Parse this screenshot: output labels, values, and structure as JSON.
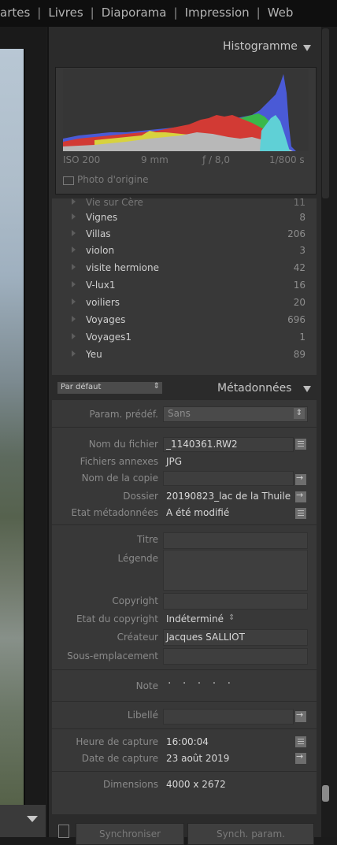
{
  "top_nav": {
    "items": [
      "artes",
      "Livres",
      "Diaporama",
      "Impression",
      "Web"
    ]
  },
  "histogram": {
    "title": "Histogramme",
    "iso": "ISO 200",
    "focal": "9 mm",
    "aperture": "ƒ / 8,0",
    "shutter": "1/800 s",
    "original_photo_label": "Photo d'origine"
  },
  "keywords": {
    "rows": [
      {
        "name": "Vie sur Cère",
        "count": "11",
        "cut": true
      },
      {
        "name": "Vignes",
        "count": "8"
      },
      {
        "name": "Villas",
        "count": "206"
      },
      {
        "name": "violon",
        "count": "3"
      },
      {
        "name": "visite hermione",
        "count": "42"
      },
      {
        "name": "V-lux1",
        "count": "16"
      },
      {
        "name": "voiliers",
        "count": "20"
      },
      {
        "name": "Voyages",
        "count": "696"
      },
      {
        "name": "Voyages1",
        "count": "1"
      },
      {
        "name": "Yeu",
        "count": "89"
      }
    ]
  },
  "metadata": {
    "preset_select": "Par défaut",
    "title": "Métadonnées",
    "preset_label": "Param. prédéf.",
    "preset_value": "Sans",
    "filename_label": "Nom du fichier",
    "filename_value": "_1140361.RW2",
    "sidecar_label": "Fichiers annexes",
    "sidecar_value": "JPG",
    "copyname_label": "Nom de la copie",
    "folder_label": "Dossier",
    "folder_value": "20190823_lac de la Thuile",
    "mdstatus_label": "Etat métadonnées",
    "mdstatus_value": "A été modifié",
    "title_label": "Titre",
    "caption_label": "Légende",
    "copyright_label": "Copyright",
    "copyright_status_label": "Etat du copyright",
    "copyright_status_value": "Indéterminé",
    "creator_label": "Créateur",
    "creator_value": "Jacques SALLIOT",
    "sublocation_label": "Sous-emplacement",
    "rating_label": "Note",
    "rating_value": "· · · · ·",
    "label_label": "Libellé",
    "capture_time_label": "Heure de capture",
    "capture_time_value": "16:00:04",
    "capture_date_label": "Date de capture",
    "capture_date_value": "23 août 2019",
    "dimensions_label": "Dimensions",
    "dimensions_value": "4000 x 2672"
  },
  "bottom": {
    "sync_label": "Synchroniser",
    "sync_settings_label": "Synch. param."
  }
}
